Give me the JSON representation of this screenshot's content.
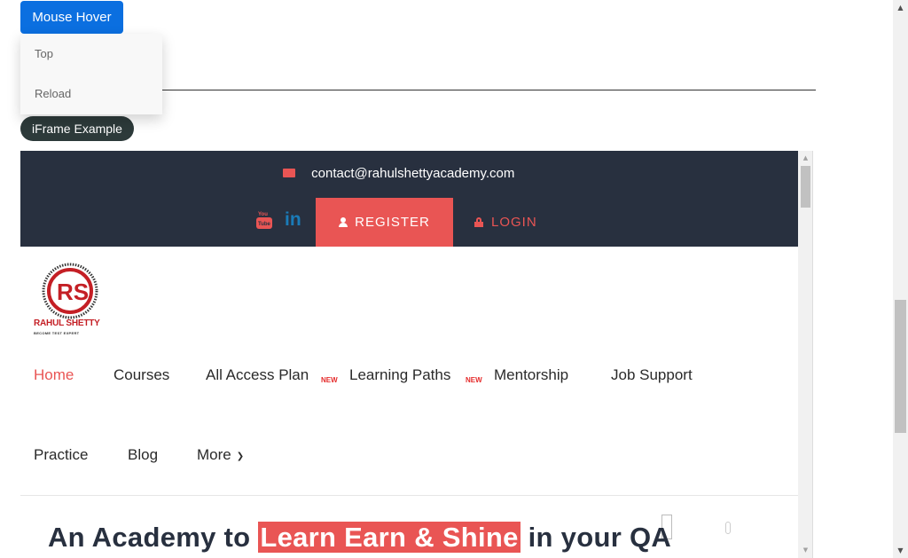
{
  "hover": {
    "button_label": "Mouse Hover",
    "menu_items": [
      "Top",
      "Reload"
    ]
  },
  "iframe_label": "iFrame Example",
  "site": {
    "contact_email": "contact@rahulshettyacademy.com",
    "social": {
      "youtube_label": "You Tube",
      "linkedin_label": "in"
    },
    "register_label": "REGISTER",
    "login_label": "LOGIN",
    "logo_title": "RAHUL SHETTY",
    "logo_tagline": "BECOME TEST EXPERT",
    "nav": [
      {
        "label": "Home",
        "active": true
      },
      {
        "label": "Courses"
      },
      {
        "label": "All Access Plan",
        "badge": "NEW"
      },
      {
        "label": "Learning Paths",
        "badge": "NEW"
      },
      {
        "label": "Mentorship"
      },
      {
        "label": "Job Support"
      },
      {
        "label": "Practice"
      },
      {
        "label": "Blog"
      },
      {
        "label": "More"
      }
    ],
    "hero": {
      "prefix": "An Academy to ",
      "highlight": "Learn Earn & Shine",
      "suffix": " in your QA"
    }
  },
  "colors": {
    "primary_button": "#0b6fe0",
    "accent": "#e95554",
    "topbar": "#28303f"
  }
}
